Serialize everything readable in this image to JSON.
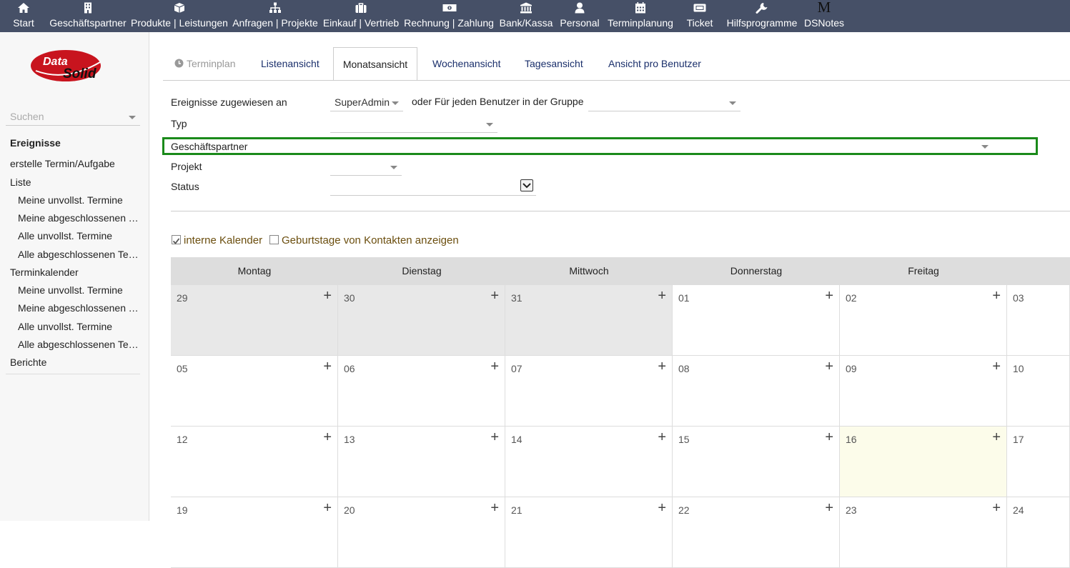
{
  "nav": [
    {
      "label": "Start",
      "icon": "home-icon"
    },
    {
      "label": "Geschäftspartner",
      "icon": "building-icon"
    },
    {
      "label": "Produkte | Leistungen",
      "icon": "box-icon"
    },
    {
      "label": "Anfragen | Projekte",
      "icon": "sitemap-icon"
    },
    {
      "label": "Einkauf | Vertrieb",
      "icon": "briefcase-icon"
    },
    {
      "label": "Rechnung | Zahlung",
      "icon": "money-icon"
    },
    {
      "label": "Bank/Kassa",
      "icon": "bank-icon"
    },
    {
      "label": "Personal",
      "icon": "user-icon"
    },
    {
      "label": "Terminplanung",
      "icon": "calendar-icon"
    },
    {
      "label": "Ticket",
      "icon": "ticket-icon"
    },
    {
      "label": "Hilfsprogramme",
      "icon": "wrench-icon"
    },
    {
      "label": "DSNotes",
      "icon": "m-icon",
      "glyph": "M"
    }
  ],
  "logo": {
    "line1": "Data",
    "line2": "Solid"
  },
  "sidebar": {
    "search_placeholder": "Suchen",
    "items": [
      {
        "label": "Ereignisse",
        "type": "head"
      },
      {
        "label": "erstelle Termin/Aufgabe",
        "type": "item"
      },
      {
        "label": "Liste",
        "type": "item"
      },
      {
        "label": "Meine unvollst. Termine",
        "type": "sub"
      },
      {
        "label": "Meine abgeschlossenen Termine",
        "type": "sub"
      },
      {
        "label": "Alle unvollst. Termine",
        "type": "sub"
      },
      {
        "label": "Alle abgeschlossenen Termine",
        "type": "sub"
      },
      {
        "label": "Terminkalender",
        "type": "item"
      },
      {
        "label": "Meine unvollst. Termine",
        "type": "sub"
      },
      {
        "label": "Meine abgeschlossenen Termine",
        "type": "sub"
      },
      {
        "label": "Alle unvollst. Termine",
        "type": "sub"
      },
      {
        "label": "Alle abgeschlossenen Termine",
        "type": "sub"
      },
      {
        "label": "Berichte",
        "type": "item"
      }
    ]
  },
  "tabs": [
    {
      "label": "Terminplan",
      "icon": "clock-icon",
      "state": "muted"
    },
    {
      "label": "Listenansicht",
      "state": "normal"
    },
    {
      "label": "Monatsansicht",
      "state": "active"
    },
    {
      "label": "Wochenansicht",
      "state": "normal"
    },
    {
      "label": "Tagesansicht",
      "state": "normal"
    },
    {
      "label": "Ansicht pro Benutzer",
      "state": "normal"
    }
  ],
  "filters": {
    "assigned_label": "Ereignisse zugewiesen an",
    "assigned_value": "SuperAdmin",
    "group_label": "oder Für jeden Benutzer in der Gruppe",
    "group_value": "",
    "typ_label": "Typ",
    "typ_value": "",
    "gp_label": "Geschäftspartner",
    "projekt_label": "Projekt",
    "projekt_value": "",
    "status_label": "Status",
    "status_value": ""
  },
  "checkboxes": {
    "internal": {
      "label": "interne Kalender",
      "checked": true
    },
    "birthdays": {
      "label": "Geburtstage von Kontakten anzeigen",
      "checked": false
    }
  },
  "calendar": {
    "days": [
      "Montag",
      "Dienstag",
      "Mittwoch",
      "Donnerstag",
      "Freitag"
    ],
    "weeks": [
      [
        {
          "d": "29",
          "s": "other"
        },
        {
          "d": "30",
          "s": "other"
        },
        {
          "d": "31",
          "s": "other"
        },
        {
          "d": "01",
          "s": ""
        },
        {
          "d": "02",
          "s": ""
        },
        {
          "d": "03",
          "s": ""
        }
      ],
      [
        {
          "d": "05",
          "s": ""
        },
        {
          "d": "06",
          "s": ""
        },
        {
          "d": "07",
          "s": ""
        },
        {
          "d": "08",
          "s": ""
        },
        {
          "d": "09",
          "s": ""
        },
        {
          "d": "10",
          "s": ""
        }
      ],
      [
        {
          "d": "12",
          "s": ""
        },
        {
          "d": "13",
          "s": ""
        },
        {
          "d": "14",
          "s": ""
        },
        {
          "d": "15",
          "s": ""
        },
        {
          "d": "16",
          "s": "today"
        },
        {
          "d": "17",
          "s": ""
        }
      ],
      [
        {
          "d": "19",
          "s": ""
        },
        {
          "d": "20",
          "s": ""
        },
        {
          "d": "21",
          "s": ""
        },
        {
          "d": "22",
          "s": ""
        },
        {
          "d": "23",
          "s": ""
        },
        {
          "d": "24",
          "s": ""
        }
      ]
    ],
    "plus": "+"
  },
  "colors": {
    "nav_bg": "#465067",
    "highlight_border": "#1a8a1a",
    "today_bg": "#fcfcea",
    "other_month_bg": "#e8e8e8"
  }
}
